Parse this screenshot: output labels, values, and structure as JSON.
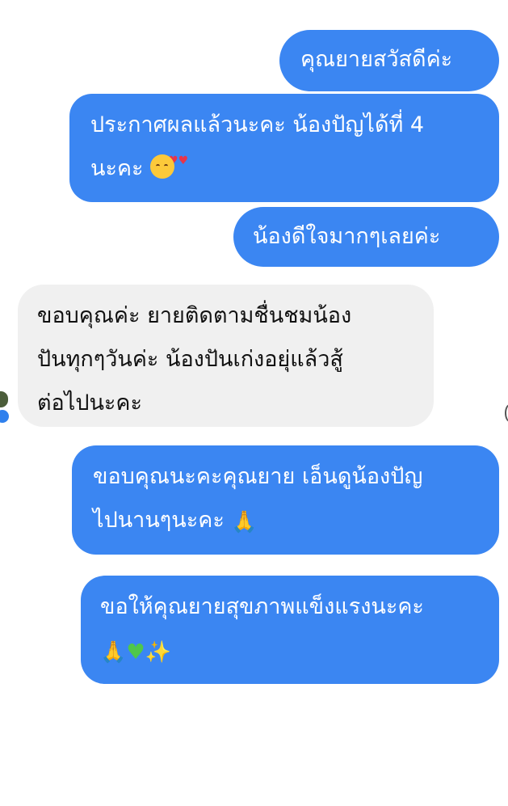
{
  "messages": [
    {
      "id": "b1",
      "direction": "outgoing",
      "lines": [
        "คุณยายสวัสดีค่ะ"
      ],
      "emoji": []
    },
    {
      "id": "b2",
      "direction": "outgoing",
      "lines": [
        "ประกาศผลแล้วนะคะ น้องปัญได้ที่ 4",
        "นะคะ"
      ],
      "emoji": [
        "smiling-face-with-hearts-emoji"
      ]
    },
    {
      "id": "b3",
      "direction": "outgoing",
      "lines": [
        "น้องดีใจมากๆเลยค่ะ"
      ],
      "emoji": []
    },
    {
      "id": "b4",
      "direction": "incoming",
      "lines": [
        "ขอบคุณค่ะ  ยายติดตามชื่นชมน้อง",
        "ปันทุกๆวันค่ะ  น้องปันเก่งอยุ่แล้วสู้",
        "ต่อไปนะคะ"
      ],
      "emoji": []
    },
    {
      "id": "b5",
      "direction": "outgoing",
      "lines": [
        "ขอบคุณนะคะคุณยาย เอ็นดูน้องปัญ",
        "ไปนานๆนะคะ"
      ],
      "emoji": [
        "folded-hands-emoji"
      ]
    },
    {
      "id": "b6",
      "direction": "outgoing",
      "lines": [
        "ขอให้คุณยายสุขภาพแข็งแรงนะคะ",
        ""
      ],
      "emoji": [
        "folded-hands-emoji",
        "green-heart-emoji",
        "sparkles-emoji"
      ]
    }
  ],
  "colors": {
    "outgoing_bubble": "#3b86f2",
    "incoming_bubble": "#f0f0f0",
    "outgoing_text": "#ffffff",
    "incoming_text": "#111111"
  }
}
